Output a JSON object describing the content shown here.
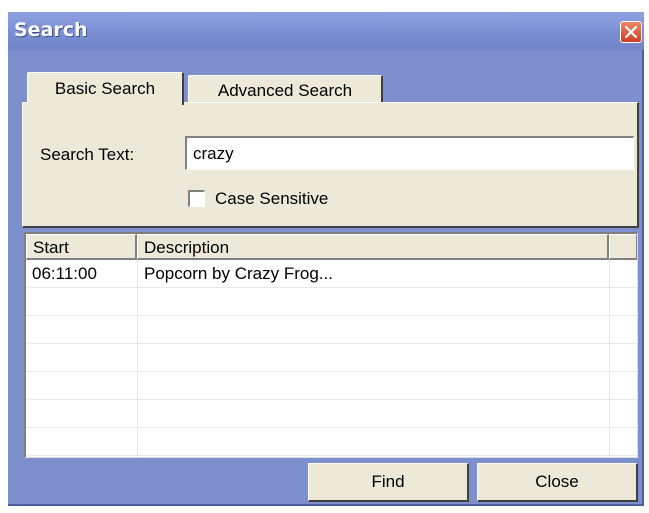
{
  "window": {
    "title": "Search"
  },
  "tabs": [
    {
      "label": "Basic Search",
      "active": true
    },
    {
      "label": "Advanced Search",
      "active": false
    }
  ],
  "search": {
    "label": "Search Text:",
    "value": "crazy"
  },
  "case_sensitive": {
    "label": "Case Sensitive",
    "checked": false
  },
  "results": {
    "columns": [
      "Start",
      "Description"
    ],
    "rows": [
      {
        "start": "06:11:00",
        "description": "Popcorn by Crazy Frog..."
      }
    ]
  },
  "buttons": {
    "find": "Find",
    "close": "Close"
  },
  "colors": {
    "window_bg": "#7d8fcd",
    "face": "#ece9d8",
    "close_red": "#cf3d21"
  },
  "icons": {
    "close": "close-icon"
  }
}
